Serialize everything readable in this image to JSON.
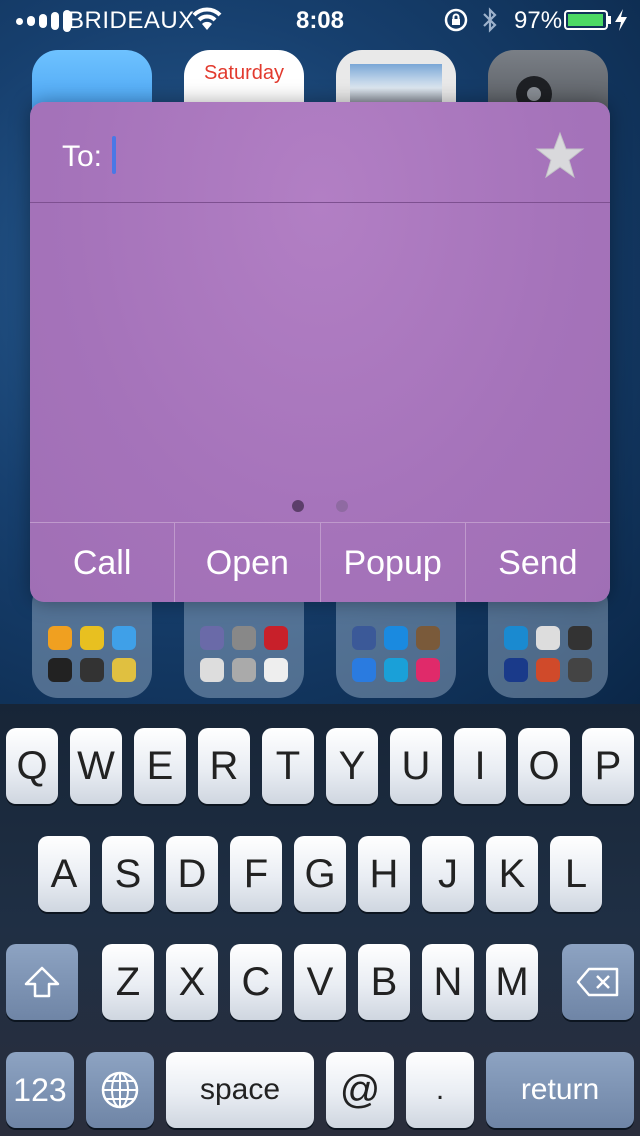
{
  "status_bar": {
    "carrier": "BRIDEAUX",
    "time": "8:08",
    "battery_percent": "97%",
    "battery_level": 0.97,
    "icons": [
      "signal-dots-icon",
      "wifi-icon",
      "rotation-lock-icon",
      "bluetooth-icon",
      "battery-icon",
      "charging-bolt-icon"
    ]
  },
  "home_screen": {
    "calendar_icon": {
      "day": "Saturday"
    }
  },
  "popup": {
    "to_label": "To:",
    "favorite_icon": "star-icon",
    "page_indicator": {
      "pages": 2,
      "current": 1
    },
    "actions": [
      "Call",
      "Open",
      "Popup",
      "Send"
    ]
  },
  "keyboard": {
    "row1": [
      "Q",
      "W",
      "E",
      "R",
      "T",
      "Y",
      "U",
      "I",
      "O",
      "P"
    ],
    "row2": [
      "A",
      "S",
      "D",
      "F",
      "G",
      "H",
      "J",
      "K",
      "L"
    ],
    "row3": [
      "Z",
      "X",
      "C",
      "V",
      "B",
      "N",
      "M"
    ],
    "numbers_key": "123",
    "space_key": "space",
    "at_key": "@",
    "period_key": ".",
    "return_key": "return",
    "shift_icon": "shift-icon",
    "globe_icon": "globe-icon",
    "delete_icon": "delete-icon"
  },
  "colors": {
    "popup_bg": "#a775bb",
    "cursor": "#4a78e6",
    "key_face": "#e9edf3",
    "function_key": "#7a8fb0"
  }
}
